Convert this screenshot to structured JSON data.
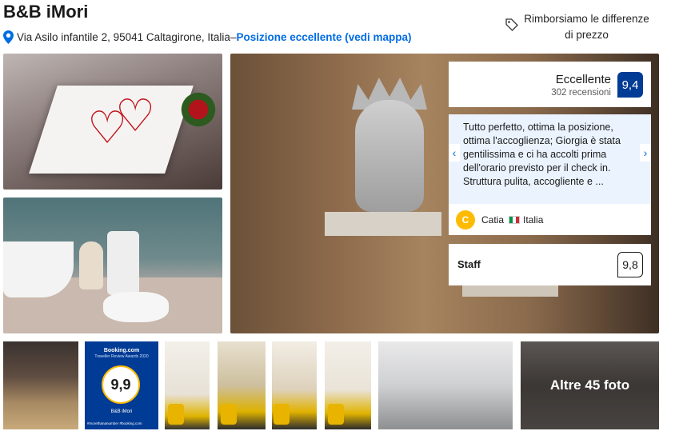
{
  "header": {
    "title": "B&B iMori",
    "address": "Via Asilo infantile 2, 95041 Caltagirone, Italia",
    "separator": " – ",
    "location_link": "Posizione eccellente (vedi mappa)",
    "price_match": "Rimborsiamo le differenze di prezzo"
  },
  "rating": {
    "label": "Eccellente",
    "count": "302 recensioni",
    "score": "9,4"
  },
  "review": {
    "text": "Tutto perfetto, ottima la posizione, ottima l'accoglienza; Giorgia è stata gentilissima e ci ha accolti prima dell'orario previsto per il check in. Struttura pulita, accogliente e ...",
    "author_initial": "C",
    "author": "Catia",
    "country": "Italia"
  },
  "staff": {
    "label": "Staff",
    "score": "9,8"
  },
  "thumb_award": {
    "brand": "Booking.com",
    "award": "Traveller Review Awards 2020",
    "score": "9,9",
    "name": "B&B iMori",
    "hashtag": "#morethananumber #booking.com"
  },
  "more_photos": "Altre 45 foto",
  "colors": {
    "brand": "#003b95",
    "link": "#006ce4",
    "review_bg": "#ebf3ff",
    "avatar": "#febb02"
  }
}
